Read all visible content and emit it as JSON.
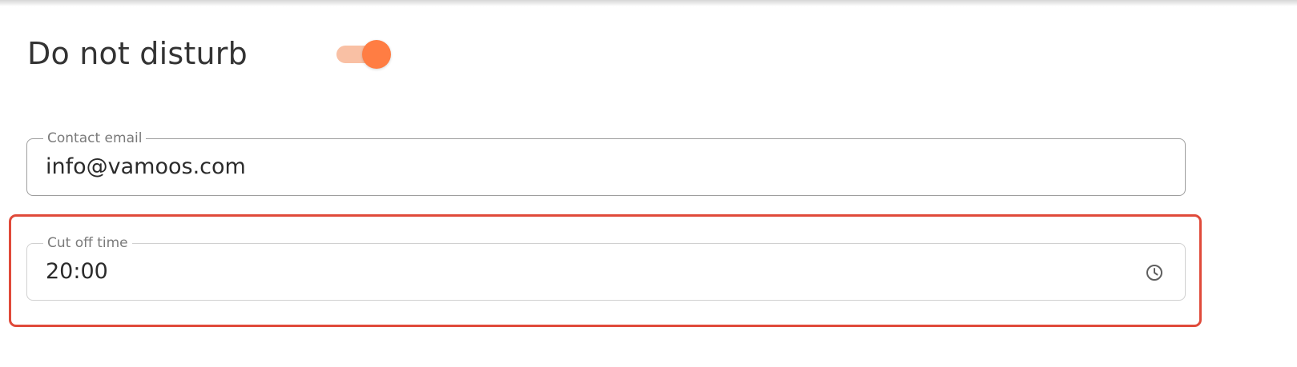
{
  "settings": {
    "do_not_disturb": {
      "title": "Do not disturb",
      "enabled": true,
      "toggle_color": "#ff7d43",
      "toggle_track_color": "#f9c0a4"
    },
    "contact_email": {
      "label": "Contact email",
      "value": "info@vamoos.com"
    },
    "cut_off_time": {
      "label": "Cut off time",
      "value": "20:00",
      "icon": "clock-icon"
    }
  },
  "highlight_color": "#e04a3a"
}
